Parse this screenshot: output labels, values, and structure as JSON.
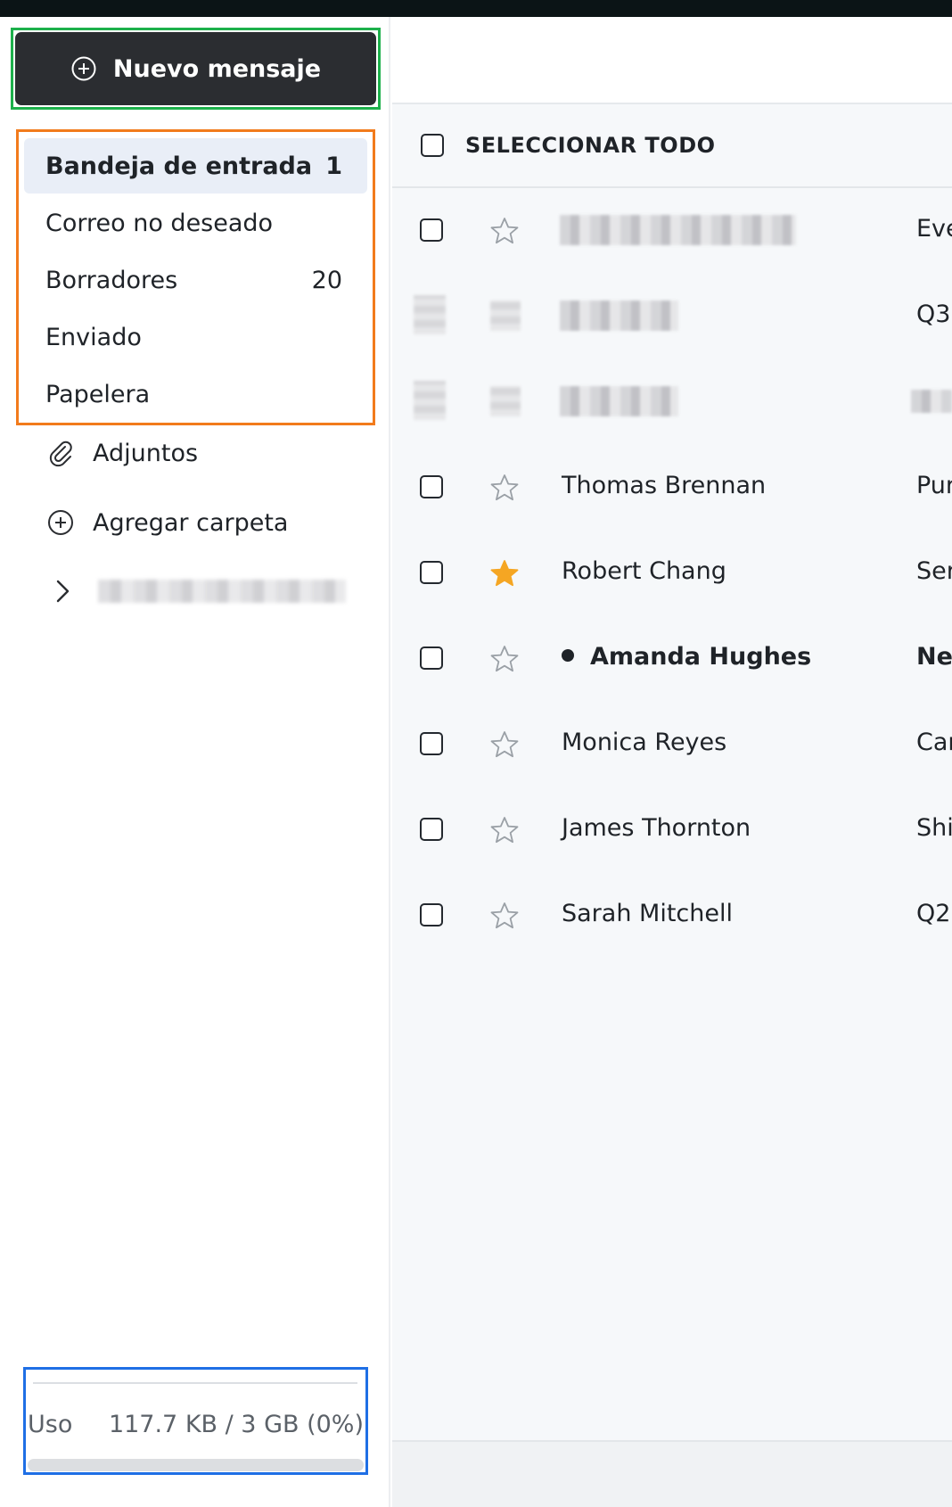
{
  "compose": {
    "label": "Nuevo mensaje",
    "icon": "plus-circle-icon"
  },
  "folders": [
    {
      "label": "Bandeja de entrada",
      "count": "1",
      "active": true
    },
    {
      "label": "Correo no deseado",
      "count": ""
    },
    {
      "label": "Borradores",
      "count": "20"
    },
    {
      "label": "Enviado",
      "count": ""
    },
    {
      "label": "Papelera",
      "count": ""
    }
  ],
  "extra_items": {
    "attachments": {
      "label": "Adjuntos",
      "icon": "paperclip-icon"
    },
    "add_folder": {
      "label": "Agregar carpeta",
      "icon": "plus-circle-icon"
    }
  },
  "usage": {
    "label": "Uso",
    "value": "117.7 KB / 3 GB (0%)",
    "percent": 0
  },
  "list": {
    "select_all_label": "SELECCIONAR TODO",
    "rows": [
      {
        "sender": "",
        "subject": "Eve",
        "starred": false,
        "unread": false,
        "redacted_sender": true
      },
      {
        "sender": "",
        "subject": "Q3",
        "starred": false,
        "unread": false,
        "redacted_sender": true,
        "redacted_controls": true
      },
      {
        "sender": "",
        "subject": "",
        "starred": false,
        "unread": false,
        "redacted_sender": true,
        "redacted_controls": true,
        "redacted_subject": true
      },
      {
        "sender": "Thomas Brennan",
        "subject": "Pur",
        "starred": false,
        "unread": false
      },
      {
        "sender": "Robert Chang",
        "subject": "Ser",
        "starred": true,
        "unread": false
      },
      {
        "sender": "Amanda Hughes",
        "subject": "Nev",
        "starred": false,
        "unread": true
      },
      {
        "sender": "Monica Reyes",
        "subject": "Car",
        "starred": false,
        "unread": false
      },
      {
        "sender": "James Thornton",
        "subject": "Shi",
        "starred": false,
        "unread": false
      },
      {
        "sender": "Sarah Mitchell",
        "subject": "Q2",
        "starred": false,
        "unread": false
      }
    ]
  },
  "colors": {
    "accent_star": "#f5a623",
    "compose_bg": "#2b2d31",
    "active_folder_bg": "#e9eef7"
  }
}
